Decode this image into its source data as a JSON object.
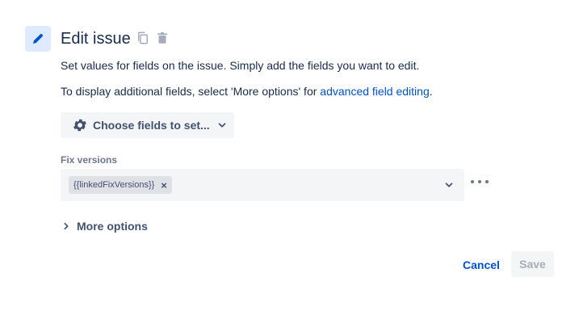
{
  "header": {
    "title": "Edit issue",
    "action_icon": "pencil-icon",
    "copy_icon": "copy-icon",
    "delete_icon": "trash-icon"
  },
  "description": {
    "line1": "Set values for fields on the issue. Simply add the fields you want to edit.",
    "line2_prefix": "To display additional fields, select 'More options' for ",
    "line2_link": "advanced field editing",
    "line2_suffix": "."
  },
  "choose_fields": {
    "label": "Choose fields to set...",
    "icon": "gear-icon"
  },
  "fix_versions": {
    "label": "Fix versions",
    "selected_tags": [
      "{{linkedFixVersions}}"
    ]
  },
  "more_options": {
    "label": "More options"
  },
  "footer": {
    "cancel_label": "Cancel",
    "save_label": "Save"
  },
  "colors": {
    "link": "#0052cc",
    "text": "#172b4d",
    "icon_bg": "#deebff",
    "field_bg": "#f4f5f7",
    "muted": "#6b778c"
  }
}
